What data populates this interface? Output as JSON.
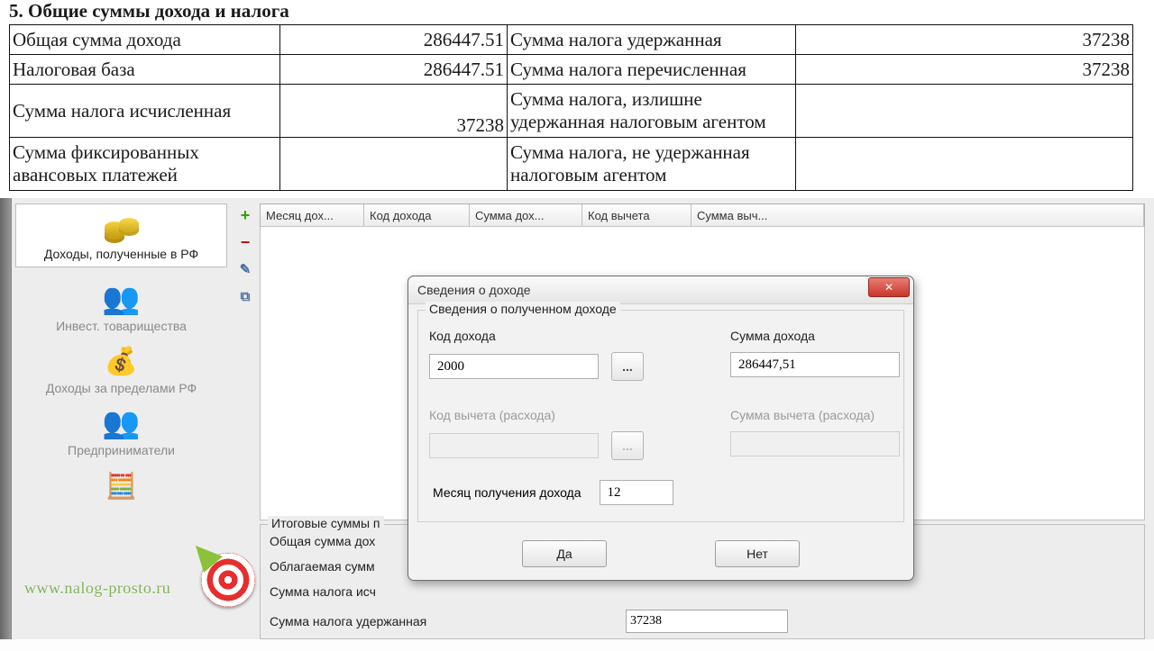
{
  "document": {
    "heading": "5. Общие суммы дохода и налога",
    "rows": [
      {
        "l_label": "Общая сумма дохода",
        "l_value": "286447.51",
        "r_label": "Сумма налога удержанная",
        "r_value": "37238"
      },
      {
        "l_label": "Налоговая база",
        "l_value": "286447.51",
        "r_label": "Сумма налога перечисленная",
        "r_value": "37238"
      },
      {
        "l_label": "Сумма налога исчисленная",
        "l_value": "37238",
        "r_label": "Сумма налога, излишне удержанная налоговым агентом",
        "r_value": ""
      },
      {
        "l_label": "Сумма фиксированных авансовых платежей",
        "l_value": "",
        "r_label": "Сумма налога, не удержанная налоговым агентом",
        "r_value": ""
      }
    ]
  },
  "sidebar": {
    "items": [
      {
        "label": "Доходы, полученные в РФ",
        "icon": "coins-icon",
        "active": true
      },
      {
        "label": "Инвест. товарищества",
        "icon": "partnership-icon"
      },
      {
        "label": "Доходы за пределами РФ",
        "icon": "money-bag-icon"
      },
      {
        "label": "Предприниматели",
        "icon": "people-icon"
      },
      {
        "label": "",
        "icon": "calc-icon"
      }
    ],
    "watermark": "www.nalog-prosto.ru"
  },
  "toolbar": {
    "add": "+",
    "remove": "−",
    "edit": "✎",
    "copy": "⧉"
  },
  "grid": {
    "headers": [
      "Месяц дох...",
      "Код дохода",
      "Сумма дох...",
      "Код вычета",
      "Сумма выч..."
    ]
  },
  "totals": {
    "legend": "Итоговые суммы п",
    "rows": [
      {
        "label": "Общая сумма дох"
      },
      {
        "label": "Облагаемая сумм"
      },
      {
        "label": "Сумма налога исч"
      },
      {
        "label": "Сумма налога удержанная",
        "value": "37238"
      }
    ]
  },
  "dialog": {
    "title": "Сведения о доходе",
    "group_legend": "Сведения о полученном доходе",
    "code_label": "Код дохода",
    "code_value": "2000",
    "lookup": "...",
    "sum_label": "Сумма дохода",
    "sum_value": "286447,51",
    "ded_code_label": "Код вычета (расхода)",
    "ded_sum_label": "Сумма вычета (расхода)",
    "month_label": "Месяц получения дохода",
    "month_value": "12",
    "yes": "Да",
    "no": "Нет"
  }
}
